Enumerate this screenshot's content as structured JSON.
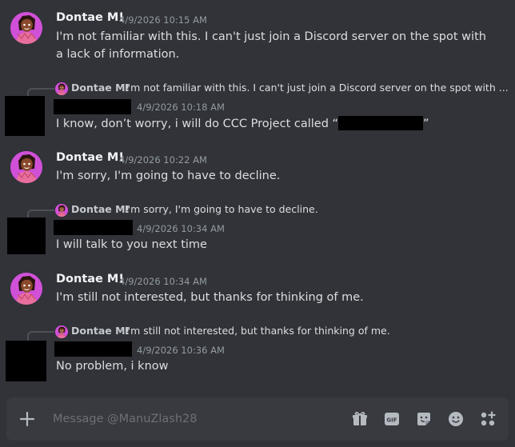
{
  "messages": [
    {
      "author": "Dontae M!",
      "time": "4/9/2026 10:15 AM",
      "text": "I'm not familiar with this. I can't just join a Discord server on the spot with a lack of information."
    },
    {
      "reply_to": {
        "author": "Dontae M!",
        "text": "I'm not familiar with this. I can't just join a Discord server on the spot with ..."
      },
      "time": "4/9/2026 10:18 AM",
      "text_before": "I know, don’t worry, i will do CCC Project called “",
      "text_after": "”"
    },
    {
      "author": "Dontae M!",
      "time": "4/9/2026 10:22 AM",
      "text": "I'm sorry, I'm going to have to decline."
    },
    {
      "reply_to": {
        "author": "Dontae M!",
        "text": "I'm sorry, I'm going to have to decline."
      },
      "time": "4/9/2026 10:34 AM",
      "text": "I will talk to you next time"
    },
    {
      "author": "Dontae M!",
      "time": "4/9/2026 10:34 AM",
      "text": "I'm still not interested, but thanks for thinking of me."
    },
    {
      "reply_to": {
        "author": "Dontae M!",
        "text": "I'm still not interested, but thanks for thinking of me."
      },
      "time": "4/9/2026 10:36 AM",
      "text": "No problem, i know"
    }
  ],
  "composer": {
    "placeholder": "Message @ManuZlash28",
    "icons": [
      "plus-icon",
      "gift-icon",
      "gif-icon",
      "sticker-icon",
      "emoji-icon",
      "apps-icon"
    ],
    "gif_label": "GIF"
  },
  "colors": {
    "background": "#313338",
    "composer": "#383a40",
    "avatar": "#d050d8",
    "redaction": "#000000"
  }
}
